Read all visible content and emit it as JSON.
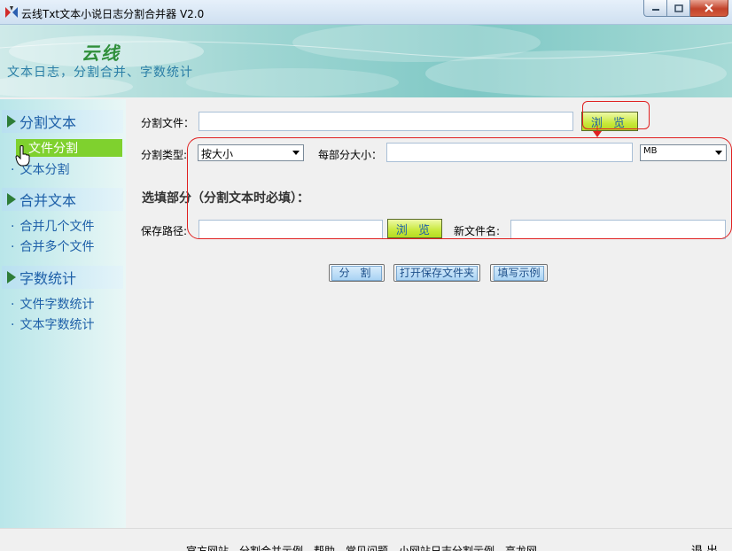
{
  "window": {
    "title": "云线Txt文本小说日志分割合并器 V2.0"
  },
  "banner": {
    "logo": "云线",
    "slogan": "文本日志，分割合并、字数统计"
  },
  "sidebar": {
    "sections": [
      {
        "label": "分割文本",
        "items": [
          "文件分割",
          "文本分割"
        ]
      },
      {
        "label": "合并文本",
        "items": [
          "合并几个文件",
          "合并多个文件"
        ]
      },
      {
        "label": "字数统计",
        "items": [
          "文件字数统计",
          "文本字数统计"
        ]
      }
    ],
    "active_item": "文件分割"
  },
  "main": {
    "split_file_label": "分割文件：",
    "split_file_value": "",
    "browse_label": "浏 览",
    "split_type_label": "分割类型:",
    "split_type_selected": "按大小",
    "part_size_label": "每部分大小：",
    "part_size_value": "",
    "unit_selected": "MB",
    "optional_heading": "选填部分（分割文本时必填）：",
    "save_path_label": "保存路径:",
    "save_path_value": "",
    "save_browse_label": "浏 览",
    "new_filename_label": "新文件名:",
    "new_filename_value": "",
    "actions": [
      "分 割",
      "打开保存文件夹",
      "填写示例"
    ]
  },
  "footer": {
    "links": "官方网站　分割合并示例　帮助　常见问题　小网站日志分割示例　高龙网",
    "exit_label": "退出"
  },
  "colors": {
    "accent_green": "#7fd12e",
    "link_blue": "#1d5fa8",
    "annotation_red": "#e02020"
  }
}
